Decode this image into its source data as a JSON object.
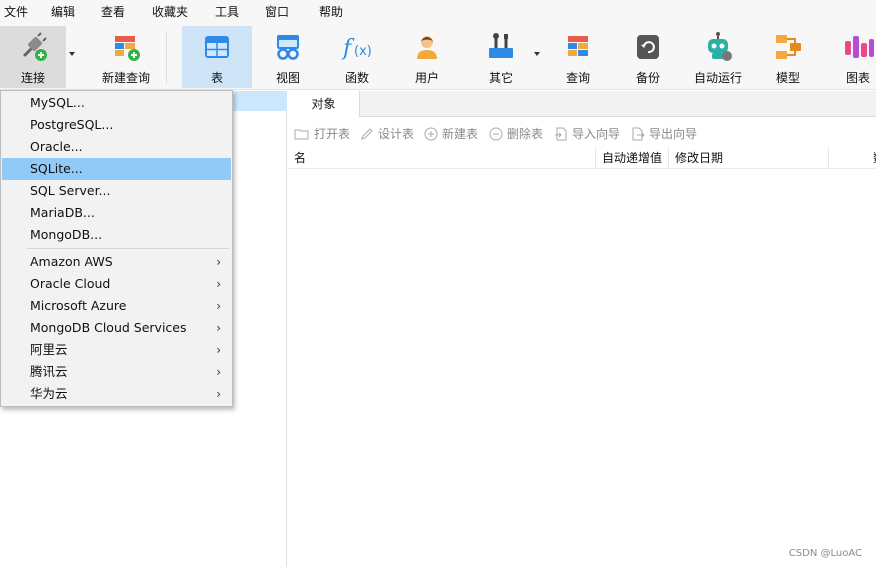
{
  "menubar": [
    "文件",
    "编辑",
    "查看",
    "收藏夹",
    "工具",
    "窗口",
    "帮助"
  ],
  "toolbar": {
    "connect": "连接",
    "new_query": "新建查询",
    "table": "表",
    "view": "视图",
    "function": "函数",
    "user": "用户",
    "other": "其它",
    "query": "查询",
    "backup": "备份",
    "auto_run": "自动运行",
    "model": "模型",
    "chart": "图表"
  },
  "tabs": {
    "objects": "对象"
  },
  "object_toolbar": {
    "open_table": "打开表",
    "design_table": "设计表",
    "new_table": "新建表",
    "delete_table": "删除表",
    "import_wizard": "导入向导",
    "export_wizard": "导出向导"
  },
  "table_headers": [
    "名",
    "自动递增值",
    "修改日期",
    "数"
  ],
  "dropdown": {
    "databases": [
      "MySQL...",
      "PostgreSQL...",
      "Oracle...",
      "SQLite...",
      "SQL Server...",
      "MariaDB...",
      "MongoDB..."
    ],
    "highlighted": "SQLite...",
    "clouds": [
      "Amazon AWS",
      "Oracle Cloud",
      "Microsoft Azure",
      "MongoDB Cloud Services",
      "阿里云",
      "腾讯云",
      "华为云"
    ],
    "submenu_arrow": "›"
  },
  "watermark": "CSDN @LuoAC",
  "colors": {
    "selection": "#91c9f7",
    "active_tab": "#cfe4f7"
  }
}
